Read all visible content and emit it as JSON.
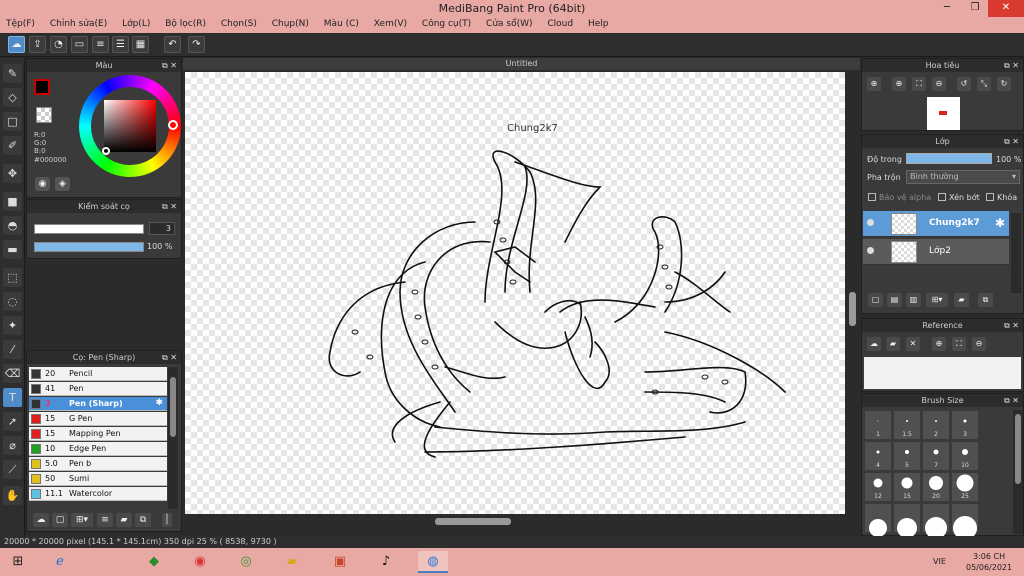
{
  "window": {
    "title": "MediBang Paint Pro (64bit)",
    "minimize": "─",
    "restore": "❐",
    "close": "✕"
  },
  "menu": [
    "Tệp(F)",
    "Chỉnh sửa(E)",
    "Lớp(L)",
    "Bộ lọc(R)",
    "Chọn(S)",
    "Chụp(N)",
    "Màu (C)",
    "Xem(V)",
    "Công cụ(T)",
    "Cửa sổ(W)",
    "Cloud",
    "Help"
  ],
  "toolbar_icons": [
    "cloud-icon",
    "share-icon",
    "comment-icon",
    "message-icon",
    "document-icon",
    "list-icon",
    "grid-icon",
    "undo-icon",
    "redo-icon"
  ],
  "tools": [
    "brush-icon",
    "eraser-icon",
    "rectangle-icon",
    "pen-icon",
    "move-icon",
    "fill-rect-icon",
    "bucket-icon",
    "gradient-icon",
    "lasso-rect-icon",
    "lasso-icon",
    "magic-wand-icon",
    "select-pen-icon",
    "select-eraser-icon",
    "text-icon",
    "operation-icon",
    "eyedropper-icon",
    "dropper-icon",
    "hand-icon"
  ],
  "color_panel": {
    "title": "Màu",
    "r": "R:0",
    "g": "G:0",
    "b": "B:0",
    "hex": "#000000",
    "fg_color": "#000000"
  },
  "brush_control": {
    "title": "Kiểm soát cọ",
    "size": "3",
    "opacity": "100 %"
  },
  "brush_panel": {
    "title": "Cọ: Pen (Sharp)",
    "brushes": [
      {
        "size": "20",
        "name": "Pencil",
        "color": "#333333"
      },
      {
        "size": "41",
        "name": "Pen",
        "color": "#333333"
      },
      {
        "size": "3",
        "name": "Pen (Sharp)",
        "color": "#333333",
        "selected": true
      },
      {
        "size": "15",
        "name": "G Pen",
        "color": "#e02020"
      },
      {
        "size": "15",
        "name": "Mapping Pen",
        "color": "#e02020"
      },
      {
        "size": "10",
        "name": "Edge Pen",
        "color": "#20a020"
      },
      {
        "size": "5.0",
        "name": "Pen b",
        "color": "#e0c020"
      },
      {
        "size": "50",
        "name": "Sumi",
        "color": "#e0c020"
      },
      {
        "size": "11.1",
        "name": "Watercolor",
        "color": "#60c0e0"
      }
    ],
    "gear": "✱"
  },
  "canvas": {
    "tab": "Untitled",
    "label": "Chung2k7"
  },
  "navigator": {
    "title": "Hoa tiêu"
  },
  "layers": {
    "title": "Lớp",
    "opacity_label": "Độ trong",
    "opacity_value": "100 %",
    "blend_label": "Pha trộn",
    "blend_value": "Bình thường",
    "protect_alpha": "Bảo vệ alpha",
    "clipping": "Xén bớt",
    "lock": "Khóa",
    "items": [
      {
        "name": "Chung2k7",
        "selected": true
      },
      {
        "name": "Lớp2",
        "selected": false
      }
    ]
  },
  "reference": {
    "title": "Reference"
  },
  "brush_size": {
    "title": "Brush Size",
    "sizes": [
      "1",
      "1.5",
      "2",
      "3",
      "4",
      "5",
      "7",
      "10",
      "12",
      "15",
      "20",
      "25"
    ]
  },
  "status": {
    "text": "20000 * 20000 pixel   (145.1 * 145.1cm)   350 dpi   25 %   ( 8538, 9730 )"
  },
  "taskbar": {
    "icons": [
      "windows-icon",
      "ie-icon",
      "bluestacks-icon",
      "chrome-icon",
      "coccoc-icon",
      "explorer-icon",
      "powerpoint-icon",
      "tiktok-icon",
      "medibang-icon"
    ],
    "lang": "VIE",
    "time": "3:06 CH",
    "date": "05/06/2021"
  }
}
